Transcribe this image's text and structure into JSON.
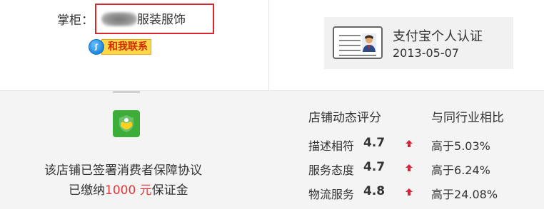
{
  "owner": {
    "label": "掌柜：",
    "shop_name": "服装服饰",
    "contact_label": "和我联系",
    "contact_icon": "wangwang-chat-icon"
  },
  "certification": {
    "title": "支付宝个人认证",
    "date": "2013-05-07",
    "icon": "id-card-icon"
  },
  "guarantee": {
    "line1": "该店铺已签署消费者保障协议",
    "line2_prefix": "已缴纳",
    "amount": "1000 元",
    "line2_suffix": "保证金",
    "icon": "shield-handshake-icon",
    "icon_color": "#3dad3a"
  },
  "ratings": {
    "header_left": "店铺动态评分",
    "header_right": "与同行业相比",
    "arrow_color": "#d4283a",
    "items": [
      {
        "label": "描述相符",
        "score": "4.7",
        "compare_prefix": "高于",
        "percent": "5.03%"
      },
      {
        "label": "服务态度",
        "score": "4.7",
        "compare_prefix": "高于",
        "percent": "6.24%"
      },
      {
        "label": "物流服务",
        "score": "4.8",
        "compare_prefix": "高于",
        "percent": "24.08%"
      }
    ]
  }
}
